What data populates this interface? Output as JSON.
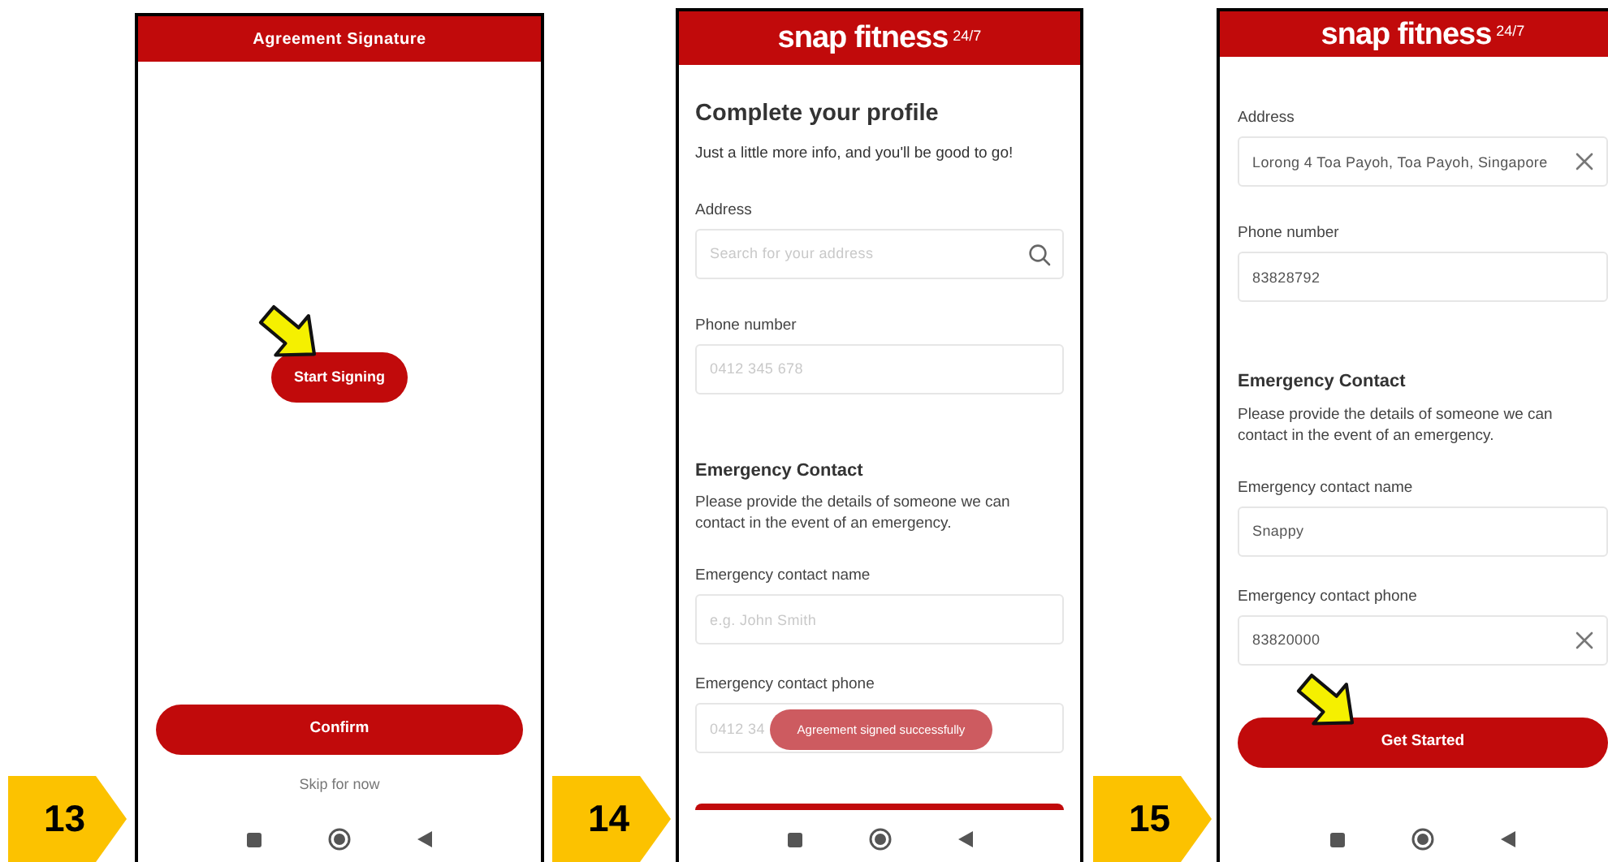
{
  "screens": [
    {
      "kind": "signature",
      "step": "13",
      "title": "Agreement Signature",
      "start_button": {
        "label": "Start Signing",
        "pointer": true
      },
      "confirm_button": "Confirm",
      "skip_link": "Skip for now"
    },
    {
      "kind": "profile",
      "step": "14",
      "logo": "snap fitness$^{24/7}$",
      "title": "Complete your profile",
      "subtitle": "Just a little more info, and you'll be good to go!",
      "fields_top": [
        {
          "label": "Address",
          "placeholder": "Search for your address",
          "search_icon": true
        },
        {
          "label": "Phone number",
          "placeholder": "0412 345 678"
        }
      ],
      "section_title": "Emergency Contact",
      "section_text": "Please provide the details of someone we can contact in the event of an emergency.",
      "fields_bottom": [
        {
          "label": "Emergency contact name",
          "placeholder": "e.g. John Smith"
        },
        {
          "label": "Emergency contact phone",
          "placeholder": "0412 34"
        }
      ],
      "toast": "Agreement signed successfully",
      "button_peek": true
    },
    {
      "kind": "profile",
      "step": "15",
      "logo": "snap fitness$^{24/7}$",
      "fields_top": [
        {
          "label": "Address",
          "value": "Lorong 4 Toa Payoh, Toa Payoh, Singapore",
          "clear_button": true
        },
        {
          "label": "Phone number",
          "value": "83828792"
        }
      ],
      "section_title": "Emergency Contact",
      "section_text": "Please provide the details of someone we can contact in the event of an emergency.",
      "fields_bottom": [
        {
          "label": "Emergency contact name",
          "value": "Snappy"
        },
        {
          "label": "Emergency contact phone",
          "value": "83820000",
          "clear_button": true
        }
      ],
      "submit_button": {
        "label": "Get Started",
        "pointer": true
      }
    }
  ]
}
